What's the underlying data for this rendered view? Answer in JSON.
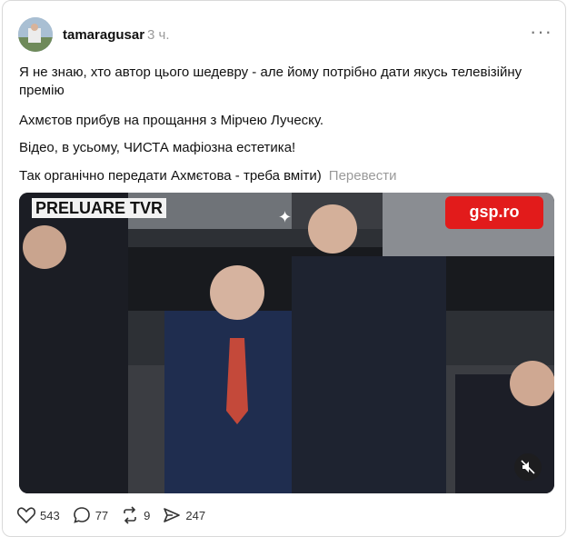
{
  "post": {
    "username": "tamaragusar",
    "time": "3 ч.",
    "more": "···",
    "lines": [
      "Я не знаю, хто автор цього шедевру - але йому потрібно дати якусь телевізійну премію",
      "Ахмєтов прибув на прощання з Мірчею Луческу.",
      "Відео, в усьому, ЧИСТА мафіозна естетика!",
      "Так органічно передати Ахмєтова - треба вміти)"
    ],
    "translate_label": "Перевести"
  },
  "video": {
    "overlay_left": "PRELUARE TVR",
    "overlay_right": "gsp.ro"
  },
  "actions": {
    "likes": "543",
    "comments": "77",
    "reposts": "9",
    "shares": "247"
  },
  "icons": [
    "avatar",
    "more-icon",
    "sparkle-icon",
    "mute-icon",
    "heart-icon",
    "comment-icon",
    "repost-icon",
    "share-icon"
  ],
  "colors": {
    "gsp_red": "#e21b1b",
    "muted_text": "#9a9a9a"
  }
}
